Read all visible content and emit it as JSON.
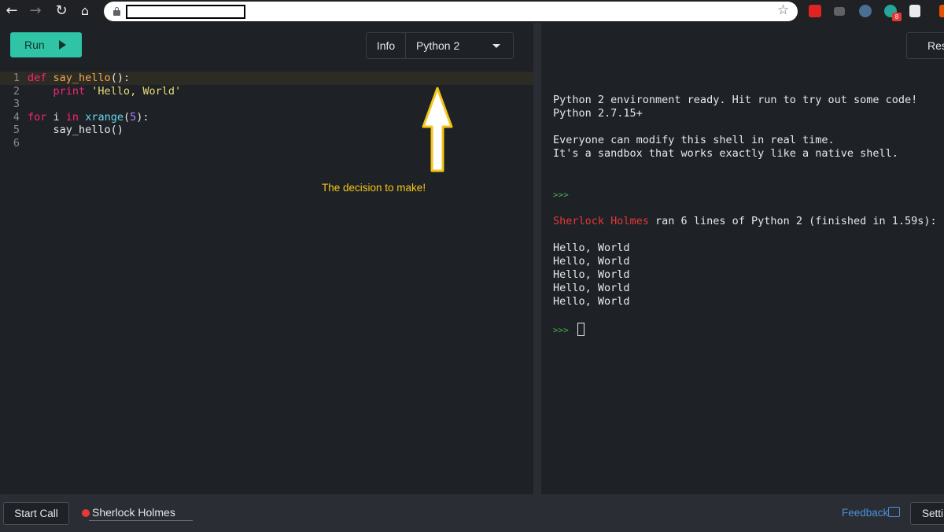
{
  "browser": {
    "icons": [
      "back-arrow-icon",
      "forward-arrow-icon",
      "reload-icon",
      "home-icon",
      "lock-icon",
      "bookmark-star-icon"
    ],
    "extension_badge": "8"
  },
  "toolbar": {
    "run_label": "Run",
    "info_label": "Info",
    "language": "Python 2",
    "reset_label": "Res"
  },
  "editor": {
    "lines": [
      {
        "num": "1",
        "tokens": [
          {
            "t": "def",
            "c": "kw"
          },
          {
            "t": " "
          },
          {
            "t": "say_hello",
            "c": "fn"
          },
          {
            "t": "():"
          }
        ]
      },
      {
        "num": "2",
        "tokens": [
          {
            "t": "    "
          },
          {
            "t": "print",
            "c": "kw"
          },
          {
            "t": " "
          },
          {
            "t": "'Hello, World'",
            "c": "str"
          }
        ]
      },
      {
        "num": "3",
        "tokens": []
      },
      {
        "num": "4",
        "tokens": [
          {
            "t": "for",
            "c": "kw"
          },
          {
            "t": " i "
          },
          {
            "t": "in",
            "c": "kw"
          },
          {
            "t": " "
          },
          {
            "t": "xrange",
            "c": "bi"
          },
          {
            "t": "("
          },
          {
            "t": "5",
            "c": "num"
          },
          {
            "t": "):"
          }
        ]
      },
      {
        "num": "5",
        "tokens": [
          {
            "t": "    say_hello()"
          }
        ]
      },
      {
        "num": "6",
        "tokens": []
      }
    ],
    "active_line": 1
  },
  "annotation": {
    "text": "The decision to make!",
    "color": "#f5c518"
  },
  "shell": {
    "ready_line": "Python 2 environment ready. Hit run to try out some code!",
    "version_line": "Python 2.7.15+",
    "modify_line": "Everyone can modify this shell in real time.",
    "sandbox_line": "It's a sandbox that works exactly like a native shell.",
    "prompt": ">>>",
    "run_user": "Sherlock Holmes",
    "run_summary": " ran 6 lines of Python 2 (finished in 1.59s):",
    "output": [
      "Hello, World",
      "Hello, World",
      "Hello, World",
      "Hello, World",
      "Hello, World"
    ]
  },
  "footer": {
    "start_call_label": "Start Call",
    "user_name": "Sherlock Holmes",
    "feedback_label": "Feedback",
    "settings_label": "Setti"
  },
  "colors": {
    "run_button": "#2ec4a5",
    "background": "#1e2126",
    "presence": "#e53935",
    "link": "#4a90d9"
  }
}
